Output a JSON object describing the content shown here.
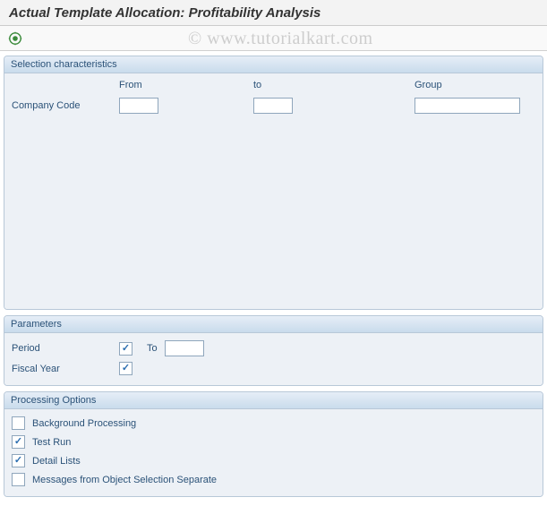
{
  "title": "Actual Template Allocation: Profitability Analysis",
  "watermark": "© www.tutorialkart.com",
  "toolbar": {
    "execute_icon": "execute-icon"
  },
  "panels": {
    "selection": {
      "title": "Selection characteristics",
      "columns": {
        "from": "From",
        "to": "to",
        "group": "Group"
      },
      "rows": {
        "company_code": {
          "label": "Company Code",
          "from": "",
          "to": "",
          "group": ""
        }
      }
    },
    "parameters": {
      "title": "Parameters",
      "period": {
        "label": "Period",
        "checked": true,
        "to_label": "To",
        "to_value": ""
      },
      "fiscal_year": {
        "label": "Fiscal Year",
        "checked": true
      }
    },
    "processing": {
      "title": "Processing Options",
      "background": {
        "label": "Background Processing",
        "checked": false
      },
      "test_run": {
        "label": "Test Run",
        "checked": true
      },
      "detail_lists": {
        "label": "Detail Lists",
        "checked": true
      },
      "msg_separate": {
        "label": "Messages from Object Selection Separate",
        "checked": false
      }
    }
  }
}
